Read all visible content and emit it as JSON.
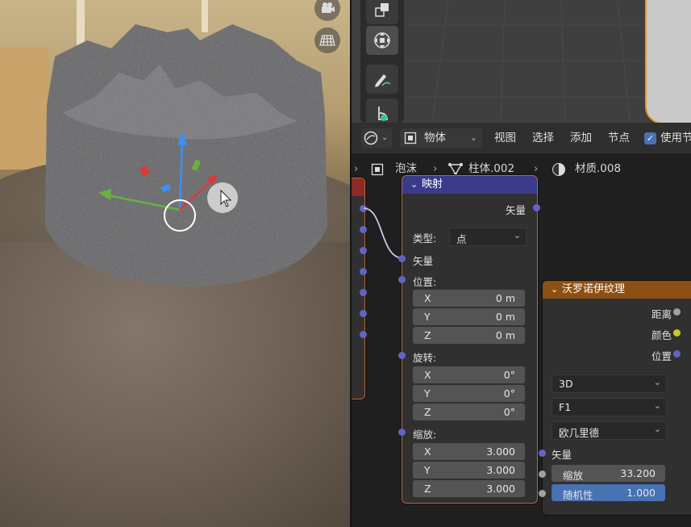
{
  "header": {
    "object_mode": "物体",
    "menu": [
      "视图",
      "选择",
      "添加",
      "节点"
    ],
    "use_nodes_label": "使用节"
  },
  "breadcrumb": {
    "object": "泡沫",
    "mesh": "柱体.002",
    "material": "材质.008"
  },
  "mapping_node": {
    "title": "映射",
    "output_vector": "矢量",
    "type_label": "类型:",
    "type_value": "点",
    "vector_in": "矢量",
    "location_label": "位置:",
    "location": [
      {
        "axis": "X",
        "value": "0 m"
      },
      {
        "axis": "Y",
        "value": "0 m"
      },
      {
        "axis": "Z",
        "value": "0 m"
      }
    ],
    "rotation_label": "旋转:",
    "rotation": [
      {
        "axis": "X",
        "value": "0°"
      },
      {
        "axis": "Y",
        "value": "0°"
      },
      {
        "axis": "Z",
        "value": "0°"
      }
    ],
    "scale_label": "缩放:",
    "scale": [
      {
        "axis": "X",
        "value": "3.000"
      },
      {
        "axis": "Y",
        "value": "3.000"
      },
      {
        "axis": "Z",
        "value": "3.000"
      }
    ]
  },
  "voronoi_node": {
    "title": "沃罗诺伊纹理",
    "outputs": [
      "距离",
      "颜色",
      "位置"
    ],
    "dimension": "3D",
    "feature": "F1",
    "metric": "欧几里德",
    "vector_in": "矢量",
    "scale_label": "缩放",
    "scale_value": "33.200",
    "randomness_label": "随机性",
    "randomness_value": "1.000"
  },
  "colors": {
    "mapping_header": "#3b3b8c",
    "voronoi_header": "#8e4f14",
    "selection_outline": "#e7952f",
    "vector_socket": "#6363c7",
    "color_socket": "#c7c729",
    "active_field": "#4772b3"
  },
  "icons": [
    "camera-icon",
    "grid-icon",
    "scale-tool-icon",
    "transform-tool-icon",
    "annotate-tool-icon",
    "measure-tool-icon",
    "shading-mode-icon",
    "object-mode-icon",
    "checkbox-icon",
    "object-icon",
    "mesh-icon",
    "material-icon"
  ]
}
